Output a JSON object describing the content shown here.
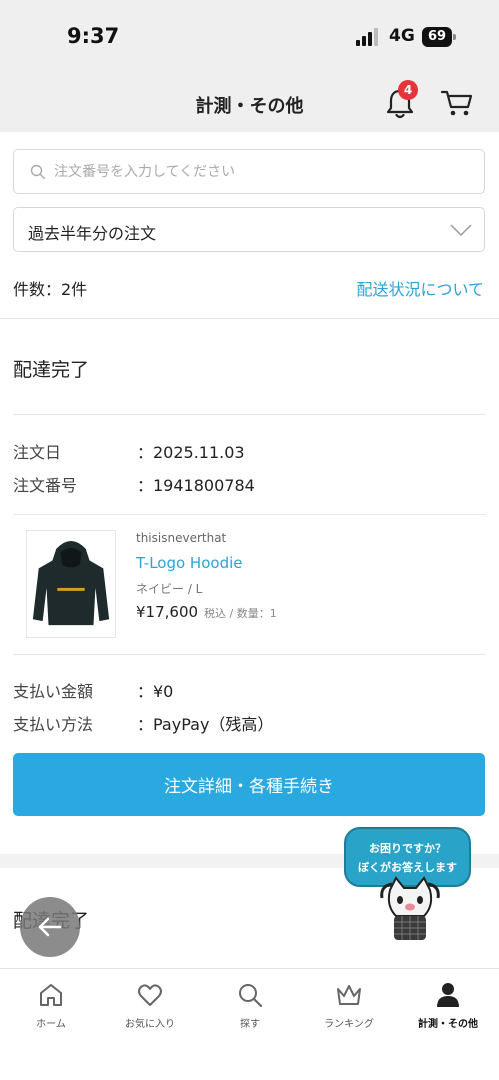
{
  "status_bar": {
    "time": "9:37",
    "network": "4G",
    "battery": "69"
  },
  "header": {
    "title": "計測・その他",
    "notification_count": "4"
  },
  "search": {
    "placeholder": "注文番号を入力してください"
  },
  "period_filter": {
    "selected": "過去半年分の注文"
  },
  "summary": {
    "count": "件数：2件",
    "delivery_link": "配送状況について"
  },
  "orders": [
    {
      "status": "配達完了",
      "order_date_label": "注文日",
      "order_date": "：2025.11.03",
      "order_number_label": "注文番号",
      "order_number": "：1941800784",
      "item": {
        "brand": "thisisneverthat",
        "name": "T-Logo Hoodie",
        "variant": "ネイビー / L",
        "price": "¥17,600",
        "price_note": "税込 / 数量：1"
      },
      "payment_amount_label": "支払い金額",
      "payment_amount": "：¥0",
      "payment_method_label": "支払い方法",
      "payment_method": "：PayPay（残高）",
      "detail_button": "注文詳細・各種手続き"
    },
    {
      "status": "配達完了"
    }
  ],
  "assistant": {
    "line1": "お困りですか？",
    "line2": "ぼくがお答えします"
  },
  "tabbar": [
    {
      "label": "ホーム",
      "icon": "home-icon"
    },
    {
      "label": "お気に入り",
      "icon": "heart-icon"
    },
    {
      "label": "探す",
      "icon": "search-icon"
    },
    {
      "label": "ランキング",
      "icon": "crown-icon"
    },
    {
      "label": "計測・その他",
      "icon": "person-icon",
      "active": true
    }
  ],
  "colors": {
    "accent": "#2aa3d8",
    "button": "#2aa8e0",
    "badge": "#e5343a"
  }
}
